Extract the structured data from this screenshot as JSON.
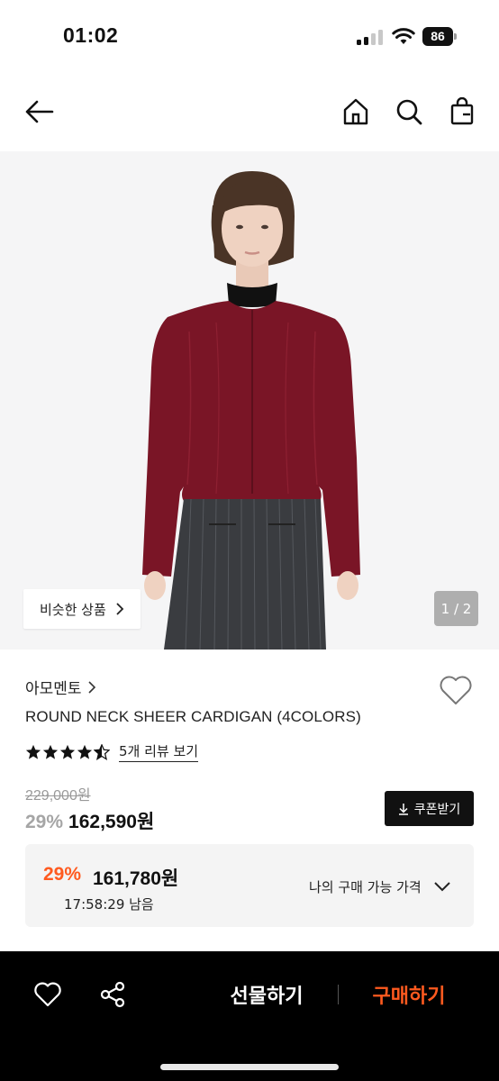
{
  "status_bar": {
    "time": "01:02",
    "battery": "86"
  },
  "product": {
    "image_counter": "1 / 2",
    "similar_label": "비슷한 상품",
    "brand": "아모멘토",
    "name": "ROUND NECK SHEER CARDIGAN (4COLORS)",
    "rating": 4.5,
    "review_link": "5개 리뷰 보기",
    "original_price": "229,000원",
    "discount_rate": "29%",
    "sale_price": "162,590원",
    "coupon_label": "쿠폰받기"
  },
  "my_price": {
    "rate": "29%",
    "price": "161,780원",
    "timer": "17:58:29 남음",
    "label": "나의 구매 가능 가격"
  },
  "bottom_bar": {
    "gift_label": "선물하기",
    "buy_label": "구매하기"
  },
  "colors": {
    "accent": "#ff5a1f",
    "cardigan": "#7a1526",
    "skirt": "#3a3c40",
    "bar": "#000000"
  },
  "icons": [
    "back-arrow-icon",
    "home-icon",
    "search-icon",
    "shopping-bag-icon",
    "chevron-right-icon",
    "heart-icon",
    "star-icon",
    "download-icon",
    "chevron-down-icon",
    "share-icon"
  ]
}
